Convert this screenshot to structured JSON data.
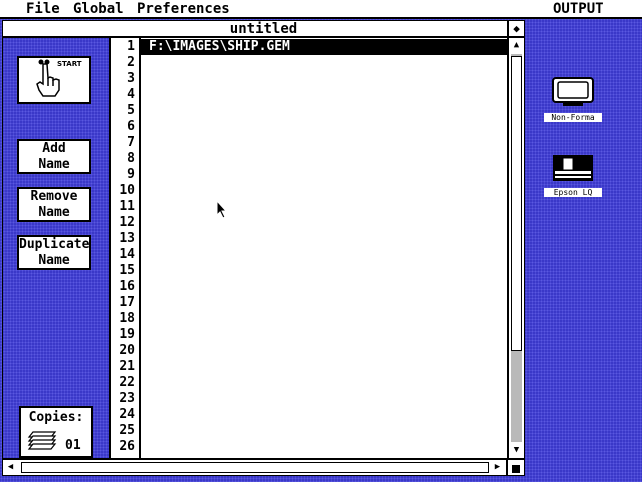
{
  "menubar": {
    "menus": [
      "File",
      "Global",
      "Preferences"
    ],
    "app_name": "OUTPUT"
  },
  "window": {
    "title": "untitled",
    "fuller_icon": "fuller-icon"
  },
  "panel": {
    "start_button": {
      "label": "START",
      "icon": "pointing-hand-icon"
    },
    "add_name": [
      "Add",
      "Name"
    ],
    "remove_name": [
      "Remove",
      "Name"
    ],
    "duplicate_name": [
      "Duplicate",
      "Name"
    ],
    "copies": {
      "label": "Copies:",
      "value": "01",
      "icon": "paper-stack-icon"
    }
  },
  "list": {
    "line_numbers": [
      "1",
      "2",
      "3",
      "4",
      "5",
      "6",
      "7",
      "8",
      "9",
      "10",
      "11",
      "12",
      "13",
      "14",
      "15",
      "16",
      "17",
      "18",
      "19",
      "20",
      "21",
      "22",
      "23",
      "24",
      "25",
      "26"
    ],
    "items": [
      {
        "text": "F:\\IMAGES\\SHIP.GEM",
        "selected": true
      }
    ]
  },
  "desktop": {
    "icons": [
      {
        "name": "monitor-icon",
        "label": "Non-Forma"
      },
      {
        "name": "printer-icon",
        "label": "Epson LQ"
      }
    ]
  },
  "colors": {
    "desktop": "#3a38c8",
    "selection": "#000000",
    "window_bg": "#ffffff"
  }
}
